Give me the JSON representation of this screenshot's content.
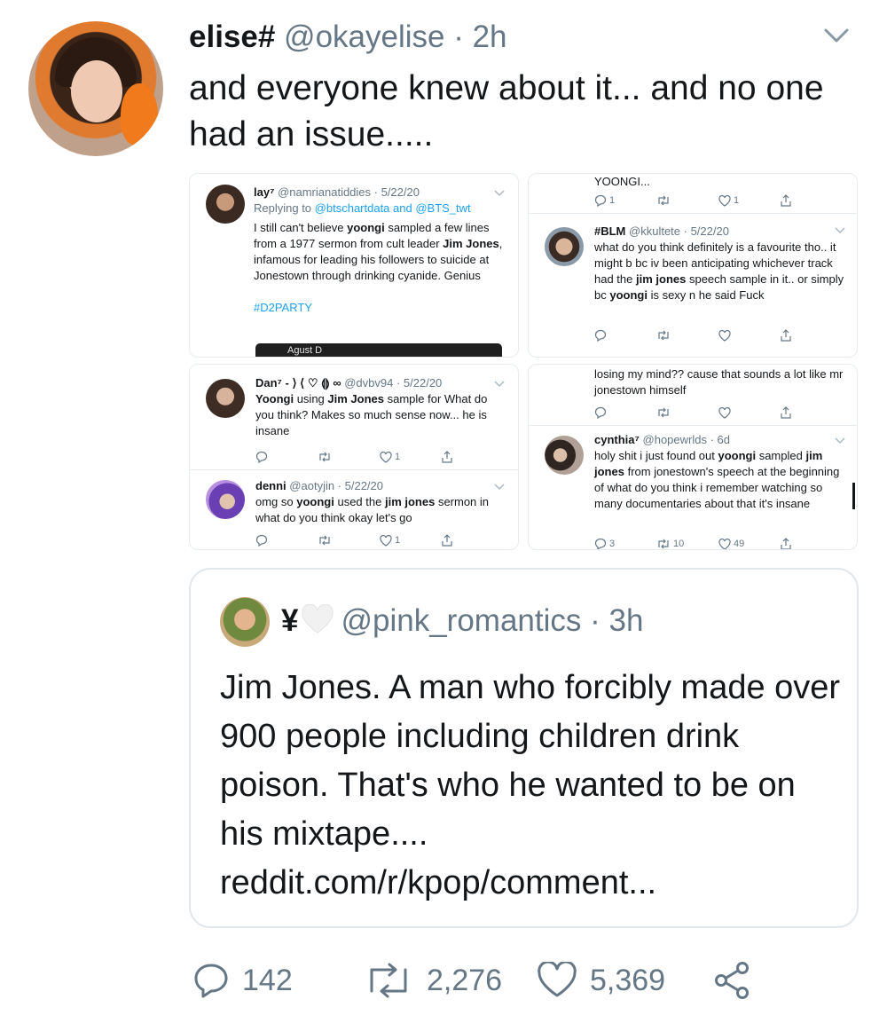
{
  "tweet": {
    "display_name": "elise#",
    "handle_time": "@okayelise · 2h",
    "text": "and everyone knew about it... and no one had an issue....."
  },
  "embedded": {
    "panel1": {
      "user_name": "lay⁷",
      "user_meta": "@namrianatiddies · 5/22/20",
      "reply_prefix": "Replying to",
      "reply_to": "@btschartdata and @BTS_twt",
      "text_parts": [
        "I still can't believe ",
        "yoongi",
        " sampled a few lines from a 1977 sermon from cult leader ",
        "Jim Jones",
        ", infamous for leading his followers to suicide at Jonestown through drinking cyanide. Genius"
      ],
      "hashtag": "#D2PARTY",
      "bar_label": "Agust D"
    },
    "panel2": {
      "prev_tail": "YOONGI...",
      "prev_reply_count": "1",
      "prev_like_count": "1",
      "user_name": "#BLM",
      "user_meta": "@kkultete · 5/22/20",
      "text_parts": [
        "what do you think definitely is a favourite tho.. it might b bc iv been anticipating whichever track had the ",
        "jim jones",
        " speech sample in it.. or simply bc ",
        "yoongi",
        " is sexy n he said Fuck"
      ]
    },
    "panel3": {
      "tweet1": {
        "user_name": "Dan⁷ - ⟩ ⟨ ♡ ⟬⟭ ∞",
        "user_meta": "@dvbv94 · 5/22/20",
        "text_parts": [
          "Yoongi",
          " using ",
          "Jim Jones",
          " sample for What do you think? Makes so much sense now... he is insane"
        ],
        "like_count": "1"
      },
      "tweet2": {
        "user_name": "denni",
        "user_meta": "@aotyjin · 5/22/20",
        "text_parts": [
          "omg so ",
          "yoongi",
          " used the ",
          "jim jones",
          " sermon in what do you think okay let's go"
        ],
        "like_count": "1"
      }
    },
    "panel4": {
      "prev_tail": "losing my mind?? cause that sounds a lot like mr jonestown himself",
      "user_name": "cynthia⁷",
      "user_meta": "@hopewrlds · 6d",
      "text_parts": [
        "holy shit i just found out ",
        "yoongi",
        " sampled ",
        "jim jones",
        " from jonestown's speech at the beginning of what do you think i remember watching so many documentaries about that it's insane"
      ],
      "reply_count": "3",
      "retweet_count": "10",
      "like_count": "49"
    }
  },
  "quoted": {
    "display_name": "¥",
    "handle_time": "@pink_romantics · 3h",
    "text": "Jim Jones. A man who forcibly made over 900 people including children drink poison. That's who he wanted to be on his mixtape.... reddit.com/r/kpop/comment..."
  },
  "footer": {
    "replies": "142",
    "retweets": "2,276",
    "likes": "5,369"
  },
  "colors": {
    "text": "#14171a",
    "secondary": "#657786",
    "link": "#1da1f2",
    "border": "#e1e8ed"
  }
}
